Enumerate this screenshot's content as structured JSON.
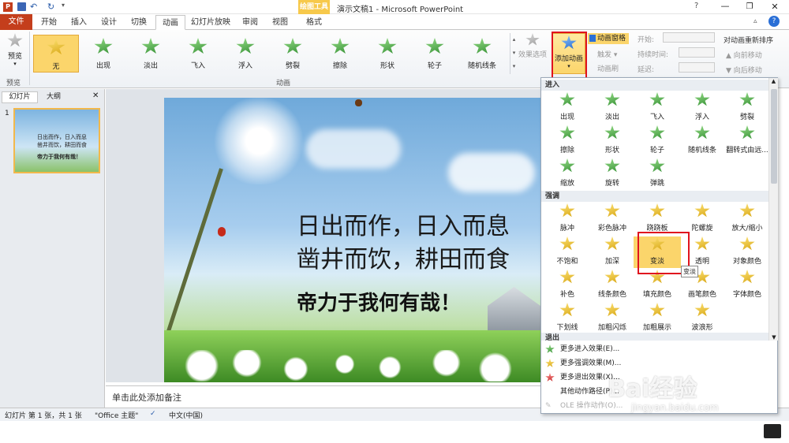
{
  "window": {
    "title": "演示文稿1 - Microsoft PowerPoint",
    "context_tab_group": "绘图工具"
  },
  "tabs": [
    "文件",
    "开始",
    "插入",
    "设计",
    "切换",
    "动画",
    "幻灯片放映",
    "审阅",
    "视图",
    "格式"
  ],
  "ribbon": {
    "preview_label": "预览",
    "preview_group": "预览",
    "animation_group": "动画",
    "effects": [
      "无",
      "出现",
      "淡出",
      "飞入",
      "浮入",
      "劈裂",
      "擦除",
      "形状",
      "轮子",
      "随机线条"
    ],
    "effect_options": "效果选项",
    "add_animation": "添加动画",
    "animation_pane": "动画窗格",
    "trigger": "触发",
    "animation_painter": "动画刷",
    "start_label": "开始:",
    "duration_label": "持续时间:",
    "delay_label": "延迟:",
    "reorder_title": "对动画重新排序",
    "move_earlier": "向前移动",
    "move_later": "向后移动"
  },
  "left_pane": {
    "tab_slides": "幻灯片",
    "tab_outline": "大纲",
    "slide_number": "1",
    "thumb_line1": "日出而作，日入而息",
    "thumb_line2": "凿井而饮，耕田而食",
    "thumb_line3": "帝力于我何有哉！"
  },
  "slide": {
    "line1": "日出而作，日入而息",
    "line2": "凿井而饮，耕田而食",
    "line3": "帝力于我何有哉！"
  },
  "notes": {
    "placeholder": "单击此处添加备注"
  },
  "status": {
    "slide_info": "幻灯片 第 1 张，共 1 张",
    "theme": "\"Office 主题\"",
    "language": "中文(中国)"
  },
  "dropdown": {
    "enter_header": "进入",
    "enter_items": [
      "出现",
      "淡出",
      "飞入",
      "浮入",
      "劈裂",
      "擦除",
      "形状",
      "轮子",
      "随机线条",
      "翻转式由远...",
      "缩放",
      "旋转",
      "弹跳"
    ],
    "emphasis_header": "强调",
    "emphasis_items": [
      "脉冲",
      "彩色脉冲",
      "跷跷板",
      "陀螺旋",
      "放大/缩小",
      "不饱和",
      "加深",
      "变淡",
      "透明",
      "对象颜色",
      "补色",
      "线条颜色",
      "填充颜色",
      "画笔颜色",
      "字体颜色",
      "下划线",
      "加粗闪烁",
      "加粗展示",
      "波浪形"
    ],
    "exit_header": "退出",
    "more_enter": "更多进入效果(E)...",
    "more_emphasis": "更多强调效果(M)...",
    "more_exit": "更多退出效果(X)...",
    "more_path": "其他动作路径(P)...",
    "ole": "OLE 操作动作(O)...",
    "tooltip": "变淡"
  },
  "watermark": {
    "brand": "Bai经验",
    "url": "jingyan.baidu.com"
  },
  "colors": {
    "accent": "#c43e1c",
    "highlight": "#fbd56b",
    "annotation_red": "#e0141e",
    "context_tab": "#f7c94b"
  }
}
